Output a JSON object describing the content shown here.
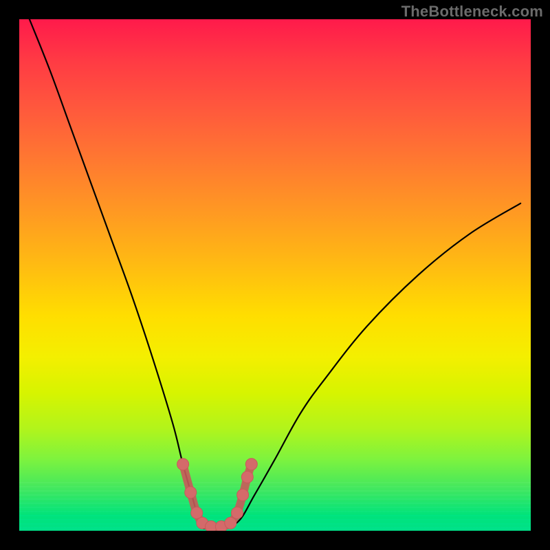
{
  "watermark": "TheBottleneck.com",
  "colors": {
    "frame_background": "#000000",
    "watermark_text": "#6b6b6b",
    "curve_stroke": "#000000",
    "bottom_marker_fill": "#d46a6a",
    "bottom_marker_stroke": "#c85a5a"
  },
  "chart_data": {
    "type": "line",
    "title": "",
    "xlabel": "",
    "ylabel": "",
    "xlim": [
      0,
      100
    ],
    "ylim": [
      0,
      100
    ],
    "grid": false,
    "legend": "none",
    "series": [
      {
        "name": "curve",
        "x": [
          2,
          6,
          10,
          14,
          18,
          22,
          26,
          30,
          32,
          34,
          35.5,
          37,
          40,
          43,
          46,
          50,
          55,
          60,
          68,
          78,
          88,
          98
        ],
        "values": [
          100,
          90,
          79,
          68,
          57,
          46,
          34,
          21,
          13,
          6,
          1,
          0.5,
          0.5,
          2,
          7,
          14,
          23,
          30,
          40,
          50,
          58,
          64
        ]
      }
    ],
    "annotations": [
      {
        "name": "bottom-accent-dots",
        "x": [
          32.0,
          33.5,
          34.7,
          35.8,
          37.5,
          39.5,
          41.3,
          42.6,
          43.7,
          44.6,
          45.4
        ],
        "values": [
          13.0,
          7.5,
          3.5,
          1.5,
          0.8,
          0.8,
          1.5,
          3.5,
          7.0,
          10.5,
          13.0
        ]
      }
    ]
  }
}
